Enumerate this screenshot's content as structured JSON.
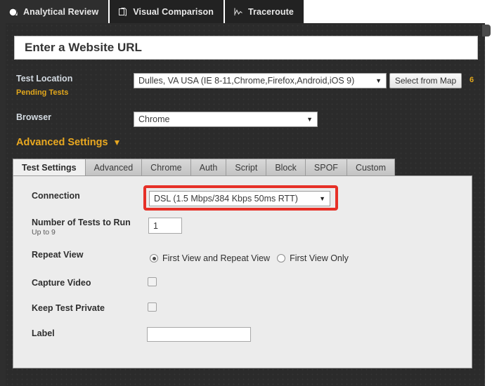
{
  "top_tabs": [
    {
      "label": "Analytical Review",
      "icon": "pie-chart-icon",
      "active": true
    },
    {
      "label": "Visual Comparison",
      "icon": "pages-icon",
      "active": false
    },
    {
      "label": "Traceroute",
      "icon": "traceroute-icon",
      "active": false
    }
  ],
  "url_field": {
    "value": "Enter a Website URL",
    "placeholder": "Enter a Website URL"
  },
  "test_location": {
    "label": "Test Location",
    "pending_label": "Pending Tests",
    "selected": "Dulles, VA USA (IE 8-11,Chrome,Firefox,Android,iOS 9)",
    "map_button": "Select from Map",
    "pending_count": "6"
  },
  "browser": {
    "label": "Browser",
    "selected": "Chrome"
  },
  "advanced_settings": {
    "label": "Advanced Settings",
    "triangle": "▼"
  },
  "inner_tabs": [
    {
      "label": "Test Settings",
      "active": true
    },
    {
      "label": "Advanced",
      "active": false
    },
    {
      "label": "Chrome",
      "active": false
    },
    {
      "label": "Auth",
      "active": false
    },
    {
      "label": "Script",
      "active": false
    },
    {
      "label": "Block",
      "active": false
    },
    {
      "label": "SPOF",
      "active": false
    },
    {
      "label": "Custom",
      "active": false
    }
  ],
  "settings": {
    "connection": {
      "label": "Connection",
      "selected": "DSL (1.5 Mbps/384 Kbps 50ms RTT)",
      "highlight_color": "#e63027"
    },
    "number_of_tests": {
      "label": "Number of Tests to Run",
      "sublabel": "Up to 9",
      "value": "1"
    },
    "repeat_view": {
      "label": "Repeat View",
      "options": [
        {
          "label": "First View and Repeat View",
          "selected": true
        },
        {
          "label": "First View Only",
          "selected": false
        }
      ]
    },
    "capture_video": {
      "label": "Capture Video",
      "checked": false
    },
    "keep_test_private": {
      "label": "Keep Test Private",
      "checked": false
    },
    "label_field": {
      "label": "Label",
      "value": ""
    }
  },
  "caret_glyph": "▼"
}
